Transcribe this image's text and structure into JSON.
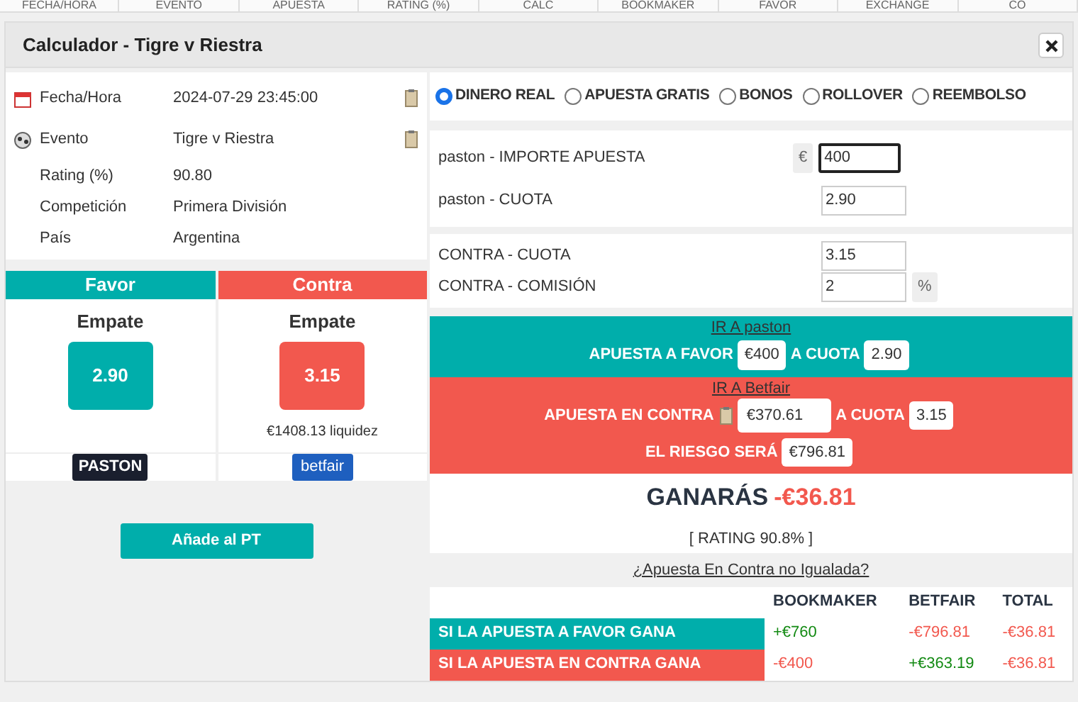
{
  "background_table": {
    "columns": [
      "FECHA/HORA",
      "EVENTO",
      "APUESTA",
      "RATING (%)",
      "CALC",
      "BOOKMAKER",
      "FAVOR",
      "EXCHANGE",
      "CO"
    ]
  },
  "window": {
    "title": "Calculador - Tigre v Riestra"
  },
  "info": [
    {
      "kind": "calendar",
      "label": "Fecha/Hora",
      "value": "2024-07-29 23:45:00",
      "copyable": true
    },
    {
      "kind": "ball",
      "label": "Evento",
      "value": "Tigre v Riestra",
      "copyable": true
    },
    {
      "kind": "none",
      "label": "Rating (%)",
      "value": "90.80",
      "copyable": false
    },
    {
      "kind": "none",
      "label": "Competición",
      "value": "Primera División",
      "copyable": false
    },
    {
      "kind": "none",
      "label": "País",
      "value": "Argentina",
      "copyable": false
    }
  ],
  "sides": [
    {
      "kind": "favor",
      "heading": "Favor",
      "selection": "Empate",
      "odds": "2.90",
      "logo": "PASTON"
    },
    {
      "kind": "contra",
      "heading": "Contra",
      "selection": "Empate",
      "odds": "3.15",
      "liquidity": "€1408.13 liquidez",
      "logo": "betfair"
    }
  ],
  "add_button": "Añade al PT",
  "modes": [
    {
      "label": "DINERO REAL",
      "selected": true
    },
    {
      "label": "APUESTA GRATIS",
      "selected": false
    },
    {
      "label": "BONOS",
      "selected": false
    },
    {
      "label": "ROLLOVER",
      "selected": false
    },
    {
      "label": "REEMBOLSO",
      "selected": false
    }
  ],
  "fields": [
    {
      "label": "paston - IMPORTE APUESTA",
      "prefix": "€",
      "value": "400",
      "focused": true
    },
    {
      "label": "paston - CUOTA",
      "value": "2.90",
      "focused": false
    }
  ],
  "contra_fields": [
    {
      "label": "CONTRA - CUOTA",
      "value": "3.15"
    },
    {
      "label": "CONTRA - COMISIÓN",
      "value": "2",
      "suffix": "%"
    }
  ],
  "favor_panel": {
    "link": "IR A paston",
    "bet_label": "APUESTA A FAVOR",
    "stake": "€400",
    "odds_label": "A CUOTA",
    "odds": "2.90"
  },
  "contra_panel": {
    "link": "IR A Betfair",
    "bet_label": "APUESTA EN CONTRA",
    "stake": "€370.61",
    "odds_label": "A CUOTA",
    "odds": "3.15",
    "risk_label": "EL RIESGO SERÁ",
    "risk": "€796.81"
  },
  "result": {
    "label": "GANARÁS",
    "amount": "-€36.81",
    "rating": "[ RATING 90.8% ]"
  },
  "unmatched_link": "¿Apuesta En Contra no Igualada?",
  "outcomes": {
    "columns": [
      "BOOKMAKER",
      "BETFAIR",
      "TOTAL"
    ],
    "rows": [
      {
        "kind": "favor",
        "label": "SI LA APUESTA A FAVOR GANA",
        "cells": [
          {
            "text": "+€760",
            "color": "#138a13"
          },
          {
            "text": "-€796.81",
            "color": "#f2584e"
          },
          {
            "text": "-€36.81",
            "color": "#f2584e"
          }
        ]
      },
      {
        "kind": "contra",
        "label": "SI LA APUESTA EN CONTRA GANA",
        "cells": [
          {
            "text": "-€400",
            "color": "#f2584e"
          },
          {
            "text": "+€363.19",
            "color": "#138a13"
          },
          {
            "text": "-€36.81",
            "color": "#f2584e"
          }
        ]
      }
    ]
  }
}
